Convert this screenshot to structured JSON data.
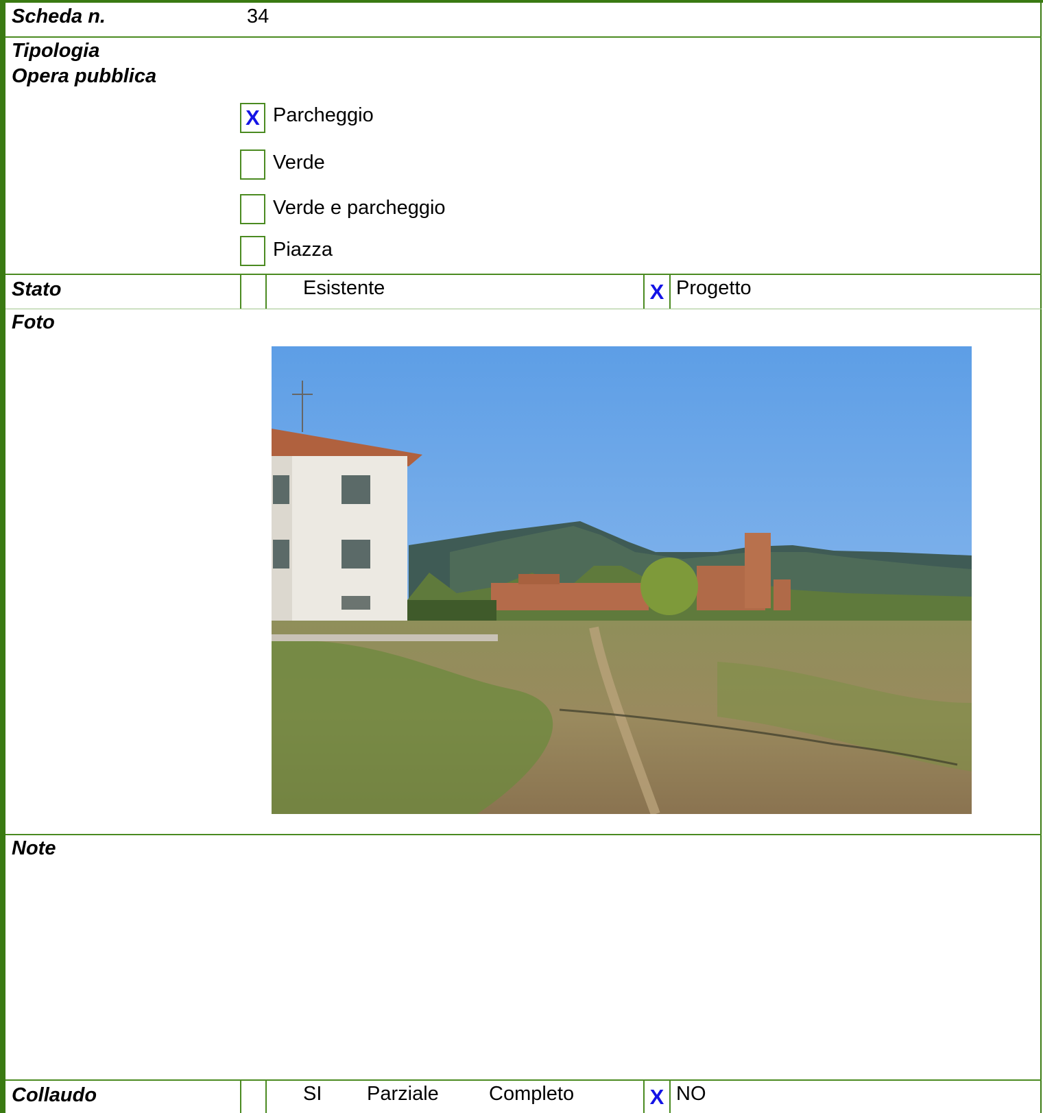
{
  "scheda": {
    "label": "Scheda n.",
    "number": "34"
  },
  "tipologia": {
    "label_line1": "Tipologia",
    "label_line2": "Opera pubblica",
    "options": [
      {
        "label": "Parcheggio",
        "checked": true,
        "mark": "X"
      },
      {
        "label": "Verde",
        "checked": false,
        "mark": ""
      },
      {
        "label": "Verde e parcheggio",
        "checked": false,
        "mark": ""
      },
      {
        "label": "Piazza",
        "checked": false,
        "mark": ""
      }
    ]
  },
  "stato": {
    "label": "Stato",
    "esistente": {
      "label": "Esistente",
      "checked": false,
      "mark": ""
    },
    "progetto": {
      "label": "Progetto",
      "checked": true,
      "mark": "X"
    }
  },
  "foto": {
    "label": "Foto"
  },
  "note": {
    "label": "Note",
    "text": ""
  },
  "collaudo": {
    "label": "Collaudo",
    "si": "SI",
    "parziale": "Parziale",
    "completo": "Completo",
    "no": {
      "label": "NO",
      "checked": true,
      "mark": "X"
    }
  },
  "colors": {
    "border": "#3a7a12",
    "check_mark": "#1414e6"
  }
}
